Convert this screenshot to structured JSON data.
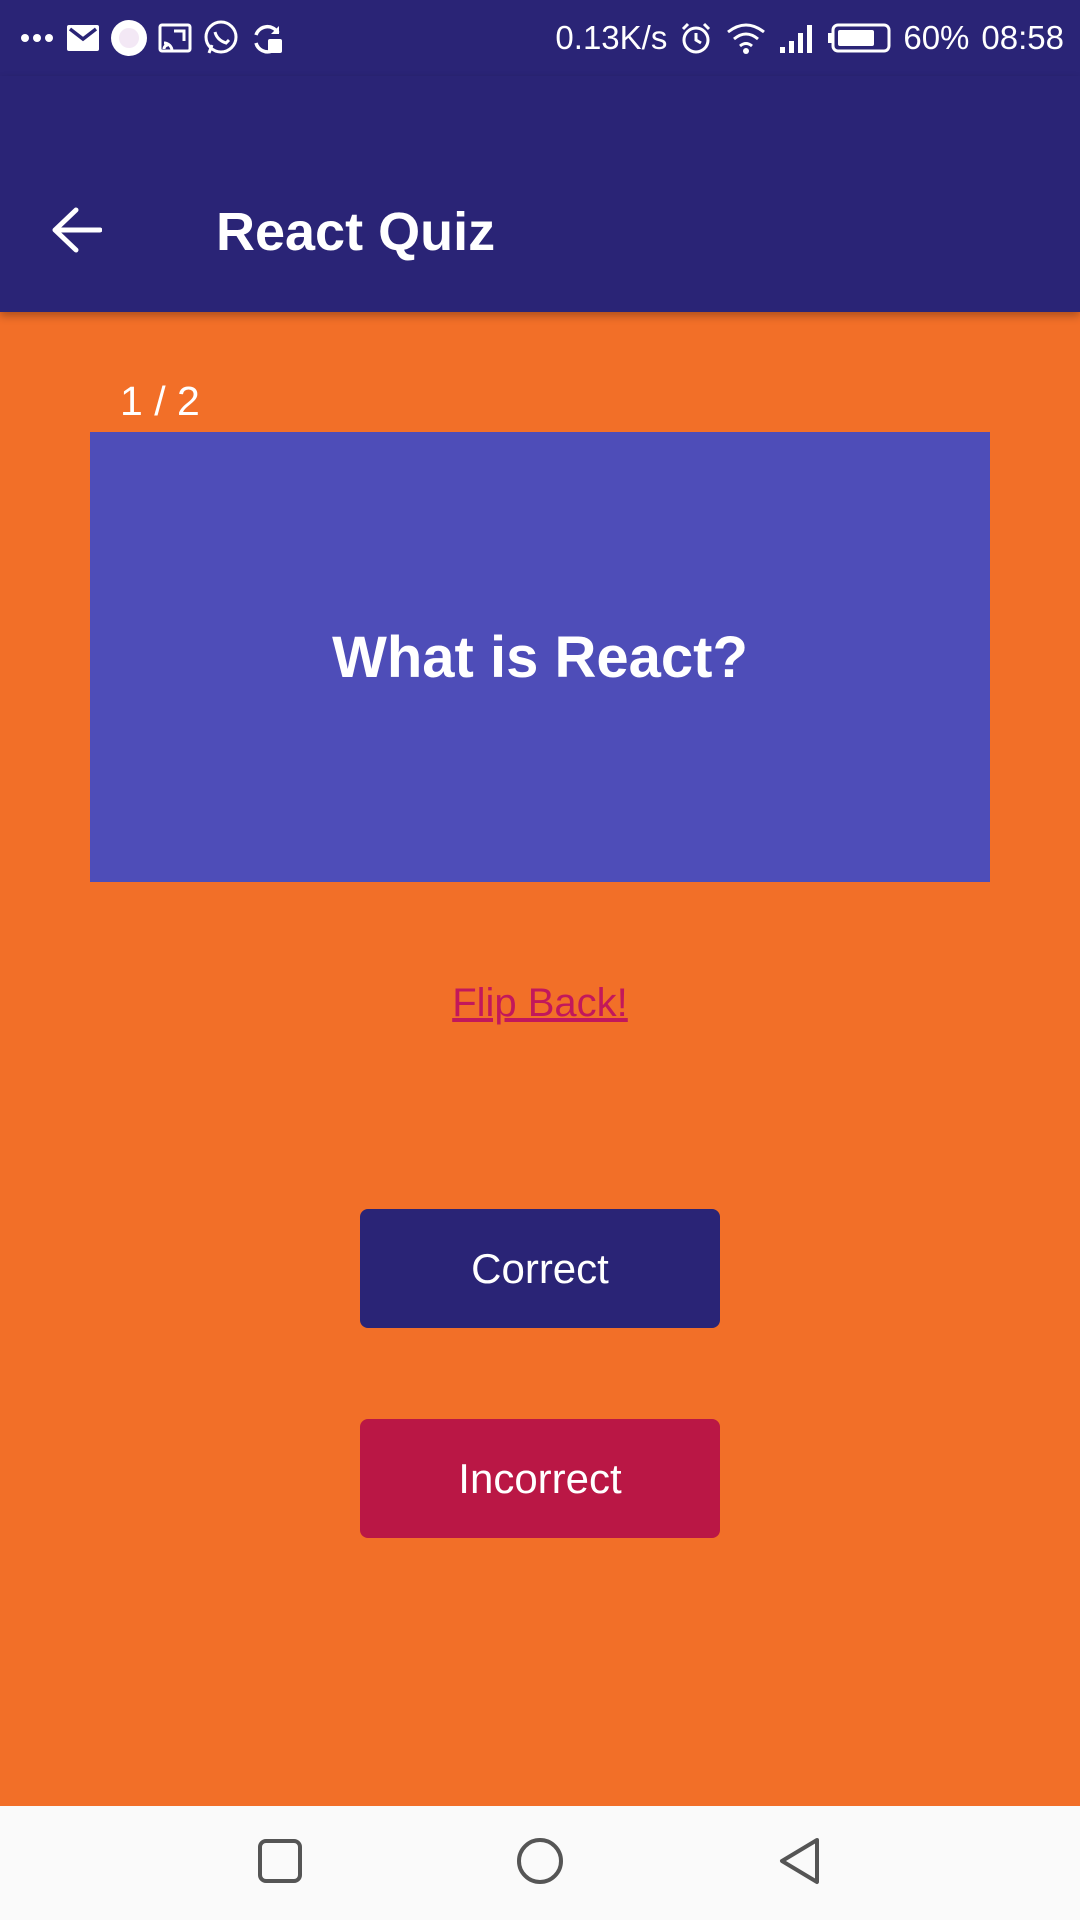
{
  "status_bar": {
    "speed": "0.13K/s",
    "battery": "60%",
    "time": "08:58",
    "left_icons": [
      "more-dots-icon",
      "gmail-icon",
      "circle-app-icon",
      "cast-icon",
      "whatsapp-icon",
      "sync-icon"
    ],
    "right_icons": [
      "alarm-icon",
      "wifi-icon",
      "signal-icon",
      "battery-icon"
    ]
  },
  "app_bar": {
    "title": "React Quiz",
    "back_icon": "arrow-left-icon"
  },
  "quiz": {
    "counter": "1 / 2",
    "question": "What is React?",
    "flip_label": "Flip Back!",
    "correct_label": "Correct",
    "incorrect_label": "Incorrect"
  },
  "nav_bar": {
    "icons": [
      "recents-icon",
      "home-icon",
      "back-icon"
    ]
  },
  "colors": {
    "background": "#F26F28",
    "app_bar": "#2A2476",
    "card": "#4E4DB8",
    "correct": "#2A2476",
    "incorrect": "#BA1745",
    "link": "#C2185B"
  }
}
